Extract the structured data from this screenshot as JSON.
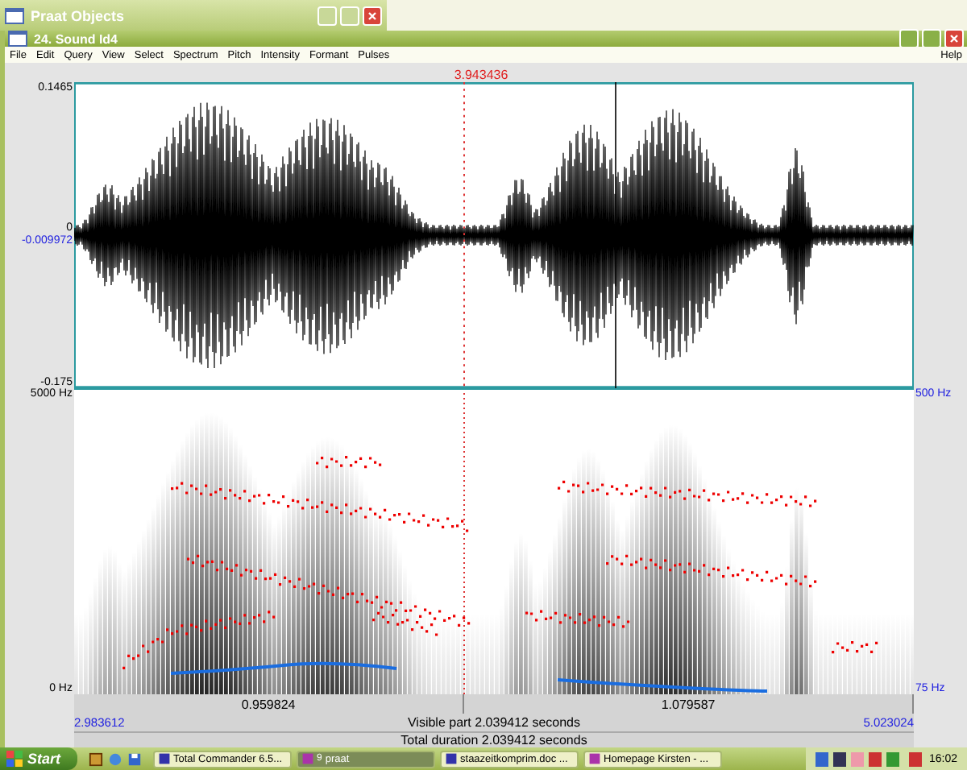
{
  "background_window": {
    "title": "Praat Objects"
  },
  "editor": {
    "title": "24. Sound Id4",
    "menu": [
      "File",
      "Edit",
      "Query",
      "View",
      "Select",
      "Spectrum",
      "Pitch",
      "Intensity",
      "Formant",
      "Pulses"
    ],
    "help": "Help",
    "cursor_time": "3.943436",
    "waveform": {
      "max": "0.1465",
      "zero": "0",
      "cursor_value": "-0.009972",
      "min": "-0.175"
    },
    "spectrogram": {
      "top": "5000 Hz",
      "bottom": "0 Hz",
      "pitch_top": "500 Hz",
      "pitch_bottom": "75 Hz"
    },
    "segments": [
      "0.959824",
      "1.079587"
    ],
    "visible": {
      "start": "2.983612",
      "label": "Visible part 2.039412 seconds",
      "end": "5.023024"
    },
    "total": "Total duration 2.039412 seconds"
  },
  "taskbar": {
    "start": "Start",
    "tasks": [
      {
        "label": "Total Commander 6.5...",
        "selected": false
      },
      {
        "label": "praat",
        "count": "9",
        "selected": true
      },
      {
        "label": "staazeitkomprim.doc ...",
        "selected": false
      },
      {
        "label": "Homepage Kirsten - ...",
        "selected": false
      }
    ],
    "clock": "16:02"
  }
}
